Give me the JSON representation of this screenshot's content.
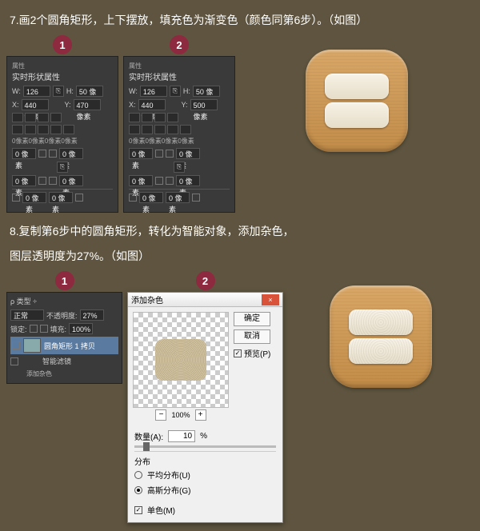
{
  "step7": {
    "text": "7.画2个圆角矩形，上下摆放，填充色为渐变色（颜色同第6步）。（如图）",
    "badge1": "1",
    "badge2": "2",
    "panel": {
      "tabLabel": "属性",
      "title": "实时形状属性",
      "wLabel": "W:",
      "hLabel": "H:",
      "xLabel": "X:",
      "yLabel": "Y:",
      "p1": {
        "w": "126 像素",
        "h": "50 像素",
        "x": "440 像素",
        "y": "470 像素"
      },
      "p2": {
        "w": "126 像素",
        "h": "50 像素",
        "x": "440 像素",
        "y": "500 像素"
      },
      "corners": "0像素0像素0像素0像素",
      "cornerField": "0 像素",
      "zeroPx": "0 像素"
    }
  },
  "step8": {
    "line1": "8.复制第6步中的圆角矩形，转化为智能对象，添加杂色，",
    "line2": "图层透明度为27%。（如图）",
    "badge1": "1",
    "badge2": "2",
    "layers": {
      "kindLabel": "类型",
      "mode": "正常",
      "opLabel": "不透明度:",
      "opacity": "27%",
      "lockLabel": "锁定:",
      "fillLabel": "填充:",
      "fill": "100%",
      "selected": "圆角矩形 1 拷贝",
      "filterLabel": "智能滤镜",
      "noiseFilter": "添加杂色"
    },
    "dialog": {
      "title": "添加杂色",
      "ok": "确定",
      "cancel": "取消",
      "previewChk": "预览(P)",
      "zoom": "100%",
      "amountLabel": "数量(A):",
      "amount": "10",
      "pct": "%",
      "distLabel": "分布",
      "uniform": "平均分布(U)",
      "gaussian": "高斯分布(G)",
      "mono": "单色(M)"
    }
  }
}
